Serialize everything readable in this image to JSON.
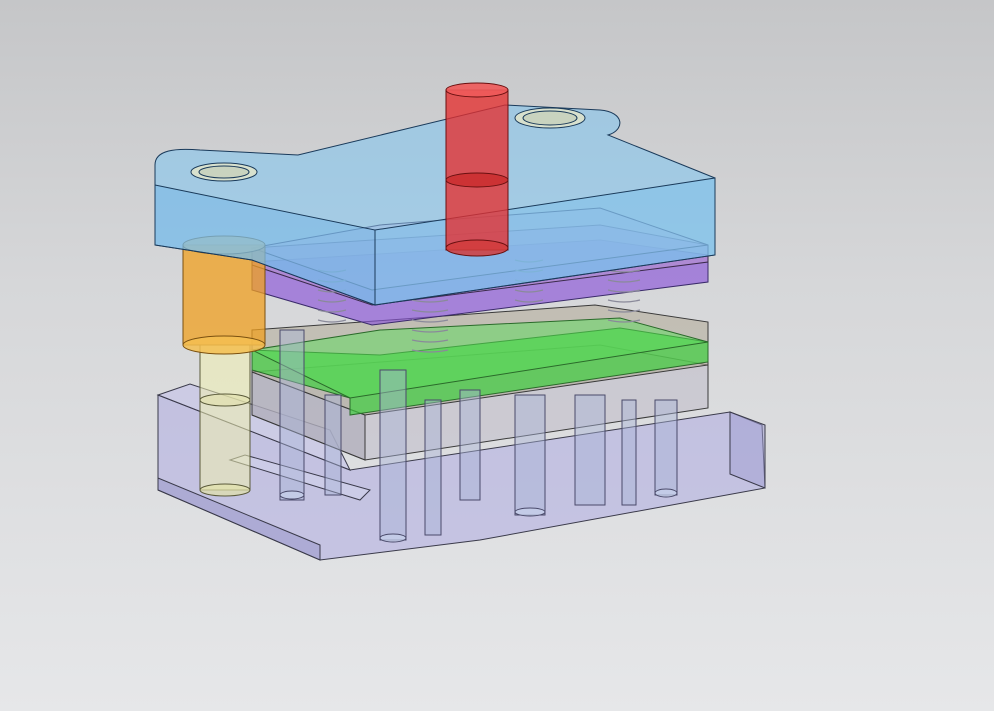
{
  "viewport": {
    "background_top": "#c5c6c8",
    "background_bottom": "#e6e7e9"
  },
  "model": {
    "type": "stamping-die-assembly-transparent",
    "components": [
      {
        "name": "top-plate",
        "color": "#7ec4f0"
      },
      {
        "name": "punch-holder-plate",
        "color": "#b58fd0"
      },
      {
        "name": "backing-plate",
        "color": "#8a55d8"
      },
      {
        "name": "stripper-plate",
        "color": "#b0aa96"
      },
      {
        "name": "stripper-insert-plate",
        "color": "#3fcf3f"
      },
      {
        "name": "die-plate",
        "color": "#c0bcc8"
      },
      {
        "name": "lower-die-shoe",
        "color": "#b3b0e0"
      },
      {
        "name": "shank",
        "color": "#e43030"
      },
      {
        "name": "guide-bushing",
        "color": "#f0a020"
      },
      {
        "name": "guide-post",
        "color": "#f0f0b0"
      },
      {
        "name": "springs",
        "color": "#d8d8e8"
      },
      {
        "name": "pins",
        "color": "#a8b4d8"
      }
    ]
  }
}
